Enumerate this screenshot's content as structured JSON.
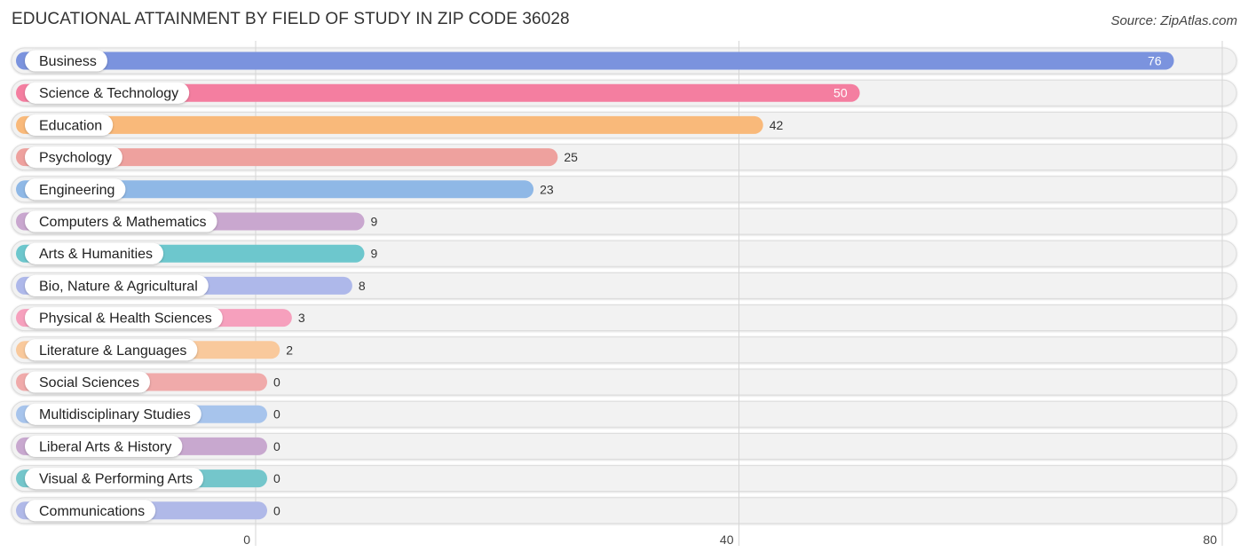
{
  "chart_data": {
    "type": "bar",
    "orientation": "horizontal",
    "title": "EDUCATIONAL ATTAINMENT BY FIELD OF STUDY IN ZIP CODE 36028",
    "source": "Source: ZipAtlas.com",
    "xlabel": "",
    "ylabel": "",
    "xlim": [
      0,
      80
    ],
    "xticks": [
      0,
      40,
      80
    ],
    "grid": true,
    "categories": [
      "Business",
      "Science & Technology",
      "Education",
      "Psychology",
      "Engineering",
      "Computers & Mathematics",
      "Arts & Humanities",
      "Bio, Nature & Agricultural",
      "Physical & Health Sciences",
      "Literature & Languages",
      "Social Sciences",
      "Multidisciplinary Studies",
      "Liberal Arts & History",
      "Visual & Performing Arts",
      "Communications"
    ],
    "values": [
      76,
      50,
      42,
      25,
      23,
      9,
      9,
      8,
      3,
      2,
      0,
      0,
      0,
      0,
      0
    ],
    "colors": [
      "#7b93de",
      "#f47ea0",
      "#f9b97a",
      "#eea19e",
      "#8fb8e6",
      "#c9a7cf",
      "#6dc7cd",
      "#aeb8ea",
      "#f6a0bd",
      "#f9c99c",
      "#f0aaaa",
      "#a7c4ec",
      "#c8a8cf",
      "#74c6cb",
      "#b0b9e8"
    ]
  }
}
